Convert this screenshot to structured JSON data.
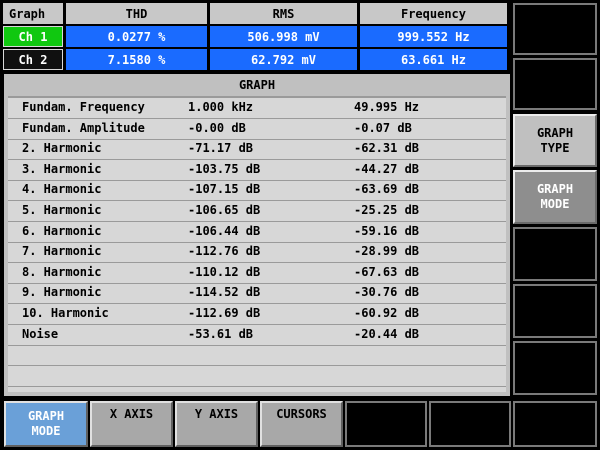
{
  "measurements": {
    "headers": [
      "Graph",
      "THD",
      "RMS",
      "Frequency"
    ],
    "rows": [
      {
        "channel": "Ch 1",
        "thd": "0.0277 %",
        "rms": "506.998 mV",
        "frequency": "999.552 Hz"
      },
      {
        "channel": "Ch 2",
        "thd": "7.1580 %",
        "rms": "62.792 mV",
        "frequency": "63.661 Hz"
      }
    ]
  },
  "graph": {
    "title": "GRAPH",
    "rows": [
      {
        "label": "Fundam. Frequency",
        "ch1": "1.000 kHz",
        "ch2": "49.995 Hz"
      },
      {
        "label": "Fundam. Amplitude",
        "ch1": "-0.00 dB",
        "ch2": "-0.07 dB"
      },
      {
        "label": "2. Harmonic",
        "ch1": "-71.17 dB",
        "ch2": "-62.31 dB"
      },
      {
        "label": "3. Harmonic",
        "ch1": "-103.75 dB",
        "ch2": "-44.27 dB"
      },
      {
        "label": "4. Harmonic",
        "ch1": "-107.15 dB",
        "ch2": "-63.69 dB"
      },
      {
        "label": "5. Harmonic",
        "ch1": "-106.65 dB",
        "ch2": "-25.25 dB"
      },
      {
        "label": "6. Harmonic",
        "ch1": "-106.44 dB",
        "ch2": "-59.16 dB"
      },
      {
        "label": "7. Harmonic",
        "ch1": "-112.76 dB",
        "ch2": "-28.99 dB"
      },
      {
        "label": "8. Harmonic",
        "ch1": "-110.12 dB",
        "ch2": "-67.63 dB"
      },
      {
        "label": "9. Harmonic",
        "ch1": "-114.52 dB",
        "ch2": "-30.76 dB"
      },
      {
        "label": "10. Harmonic",
        "ch1": "-112.69 dB",
        "ch2": "-60.92 dB"
      },
      {
        "label": "Noise",
        "ch1": "-53.61 dB",
        "ch2": "-20.44 dB"
      }
    ]
  },
  "side_keys": {
    "graph_type": "GRAPH\nTYPE",
    "graph_mode": "GRAPH\nMODE"
  },
  "bottom_keys": {
    "graph_mode": "GRAPH\nMODE",
    "x_axis": "X AXIS",
    "y_axis": "Y AXIS",
    "cursors": "CURSORS"
  },
  "colors": {
    "value_cell": "#1a6bff",
    "ch1_badge": "#10c810",
    "ch2_badge": "#101010",
    "active_key": "#6aa0d8"
  }
}
